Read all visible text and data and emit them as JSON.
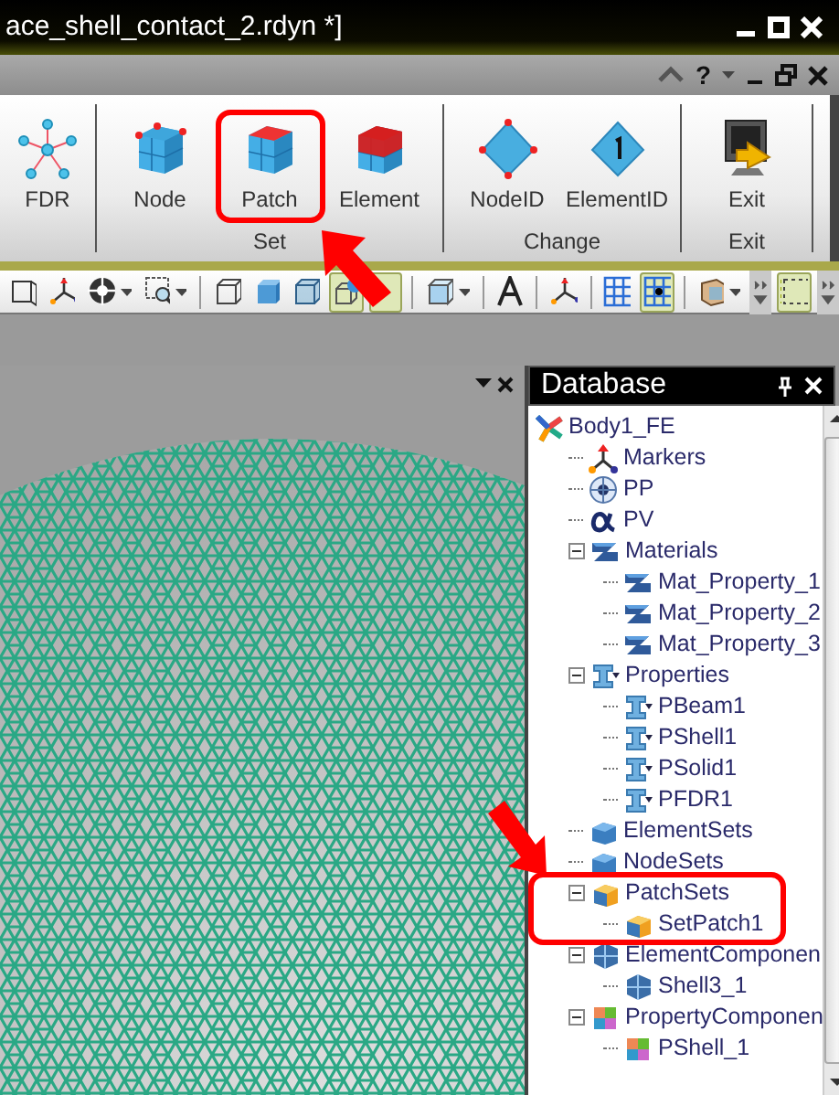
{
  "window": {
    "title": "ace_shell_contact_2.rdyn *]"
  },
  "ribbon_bar": {
    "help": "?"
  },
  "ribbon": {
    "groups": [
      {
        "buttons": [
          {
            "label": "FDR",
            "kind": "fdr",
            "highlighted": false
          }
        ]
      },
      {
        "label": "Set",
        "buttons": [
          {
            "label": "Node",
            "kind": "node",
            "highlighted": false
          },
          {
            "label": "Patch",
            "kind": "patch",
            "highlighted": true
          },
          {
            "label": "Element",
            "kind": "element",
            "highlighted": false
          }
        ]
      },
      {
        "label": "Change",
        "buttons": [
          {
            "label": "NodeID",
            "kind": "nodeid",
            "highlighted": false
          },
          {
            "label": "ElementID",
            "kind": "elementid",
            "highlighted": false
          }
        ]
      },
      {
        "label": "Exit",
        "buttons": [
          {
            "label": "Exit",
            "kind": "exit",
            "highlighted": false
          }
        ]
      }
    ]
  },
  "toolbar": [
    {
      "kind": "view-box",
      "pressed": false,
      "dropdown": false
    },
    {
      "kind": "axes",
      "pressed": false,
      "dropdown": false
    },
    {
      "kind": "target",
      "pressed": false,
      "dropdown": true
    },
    {
      "kind": "zoom",
      "pressed": false,
      "dropdown": true
    },
    {
      "kind": "separator"
    },
    {
      "kind": "wire-cube",
      "pressed": false,
      "dropdown": false
    },
    {
      "kind": "solid-cube",
      "pressed": false,
      "dropdown": false
    },
    {
      "kind": "trans-cube",
      "pressed": false,
      "dropdown": false
    },
    {
      "kind": "cube-sphere",
      "pressed": true,
      "dropdown": false
    },
    {
      "kind": "blank",
      "pressed": true,
      "dropdown": false
    },
    {
      "kind": "separator"
    },
    {
      "kind": "light-cube",
      "pressed": false,
      "dropdown": true
    },
    {
      "kind": "separator"
    },
    {
      "kind": "letter-a",
      "pressed": false,
      "dropdown": false
    },
    {
      "kind": "separator"
    },
    {
      "kind": "axes",
      "pressed": false,
      "dropdown": false
    },
    {
      "kind": "separator"
    },
    {
      "kind": "grid",
      "pressed": false,
      "dropdown": false
    },
    {
      "kind": "grid-dot",
      "pressed": true,
      "dropdown": false
    },
    {
      "kind": "separator"
    },
    {
      "kind": "tan-cube",
      "pressed": false,
      "dropdown": true
    },
    {
      "kind": "overflow"
    },
    {
      "kind": "select-box",
      "pressed": true,
      "dropdown": false
    },
    {
      "kind": "overflow"
    }
  ],
  "database": {
    "title": "Database",
    "tree": [
      {
        "label": "Body1_FE",
        "kind": "body",
        "highlighted": false,
        "children": [
          {
            "label": "Markers",
            "kind": "marker",
            "highlighted": false
          },
          {
            "label": "PP",
            "kind": "point",
            "highlighted": false
          },
          {
            "label": "PV",
            "kind": "alpha",
            "highlighted": false
          },
          {
            "label": "Materials",
            "kind": "material",
            "expanded": true,
            "highlighted": false,
            "children": [
              {
                "label": "Mat_Property_1",
                "kind": "material",
                "highlighted": false
              },
              {
                "label": "Mat_Property_2",
                "kind": "material",
                "highlighted": false
              },
              {
                "label": "Mat_Property_3",
                "kind": "material",
                "highlighted": false
              }
            ]
          },
          {
            "label": "Properties",
            "kind": "property",
            "expanded": true,
            "highlighted": false,
            "children": [
              {
                "label": "PBeam1",
                "kind": "property",
                "highlighted": false
              },
              {
                "label": "PShell1",
                "kind": "property",
                "highlighted": false
              },
              {
                "label": "PSolid1",
                "kind": "property",
                "highlighted": false
              },
              {
                "label": "PFDR1",
                "kind": "property",
                "highlighted": false
              }
            ]
          },
          {
            "label": "ElementSets",
            "kind": "set-element",
            "highlighted": false
          },
          {
            "label": "NodeSets",
            "kind": "set-node",
            "highlighted": false
          },
          {
            "label": "PatchSets",
            "kind": "set-patch",
            "expanded": true,
            "highlighted": true,
            "children": [
              {
                "label": "SetPatch1",
                "kind": "set-patch",
                "highlighted": false
              }
            ]
          },
          {
            "label": "ElementComponen",
            "kind": "component-element",
            "expanded": true,
            "highlighted": false,
            "children": [
              {
                "label": "Shell3_1",
                "kind": "component-element",
                "highlighted": false
              }
            ]
          },
          {
            "label": "PropertyComponen",
            "kind": "component-property",
            "expanded": true,
            "highlighted": false,
            "children": [
              {
                "label": "PShell_1",
                "kind": "component-property",
                "highlighted": false
              }
            ]
          }
        ]
      }
    ]
  }
}
